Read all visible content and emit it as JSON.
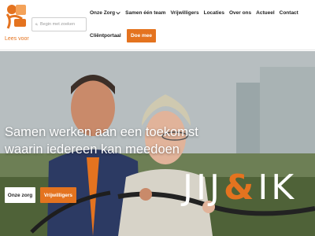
{
  "header": {
    "logo_name": "logo",
    "lees_voor": "Lees voor",
    "search": {
      "placeholder": "Begin met zoeken"
    },
    "nav": [
      {
        "label": "Onze Zorg",
        "has_dropdown": true
      },
      {
        "label": "Samen één team"
      },
      {
        "label": "Vrijwilligers"
      },
      {
        "label": "Locaties"
      },
      {
        "label": "Over ons"
      },
      {
        "label": "Actueel"
      },
      {
        "label": "Contact"
      }
    ],
    "portal_label": "Cliëntportaal",
    "doe_mee_label": "Doe mee"
  },
  "hero": {
    "title": "Samen werken aan een toekomst waarin iedereen kan meedoen",
    "buttons": {
      "onze_zorg": "Onze zorg",
      "vrijwilligers": "Vrijwilligers"
    },
    "brand_left": "JIJ",
    "brand_amp": "&",
    "brand_right": "IK"
  },
  "colors": {
    "accent": "#e4731f",
    "text": "#222222",
    "header_bg": "#ffffff"
  }
}
